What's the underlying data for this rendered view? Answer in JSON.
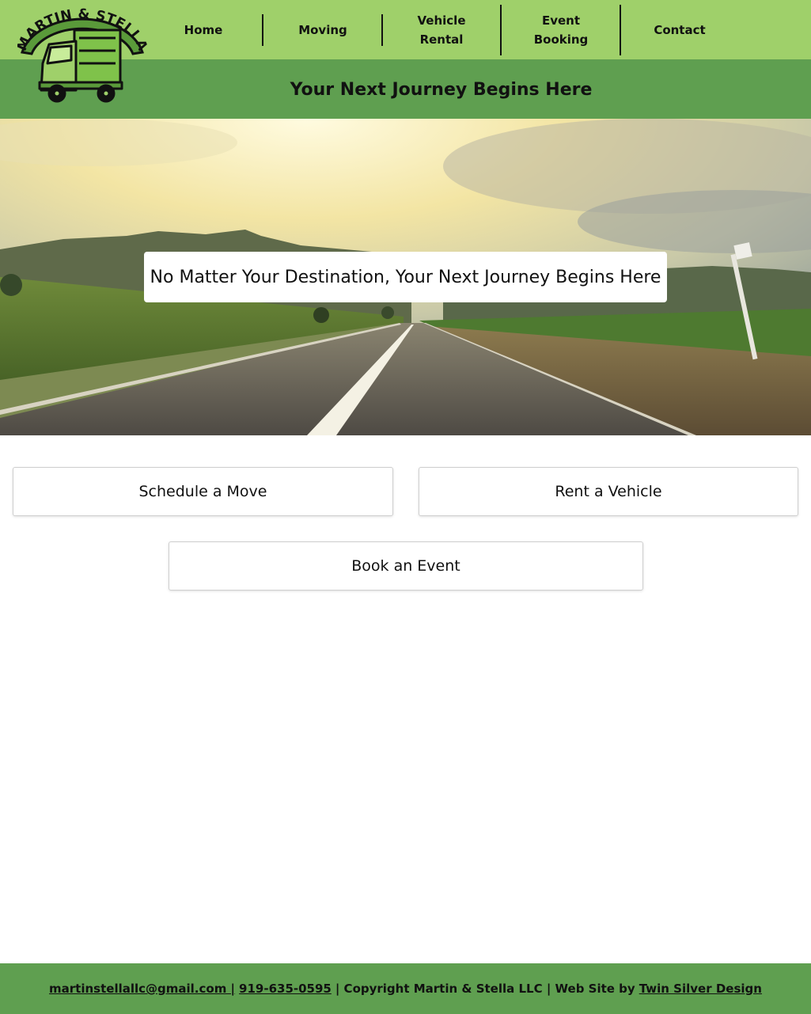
{
  "brand": {
    "logo_text": "MARTIN & STELLA"
  },
  "nav": {
    "items": [
      {
        "label": "Home"
      },
      {
        "label": "Moving"
      },
      {
        "label": "Vehicle\nRental"
      },
      {
        "label": "Event\nBooking"
      },
      {
        "label": "Contact"
      }
    ]
  },
  "subheader": {
    "title": "Your Next Journey Begins Here"
  },
  "hero": {
    "banner_text": "No Matter Your Destination, Your Next Journey Begins Here"
  },
  "actions": {
    "schedule_move": "Schedule a Move",
    "rent_vehicle": "Rent a Vehicle",
    "book_event": "Book an Event"
  },
  "footer": {
    "email": "martinstellallc@gmail.com |",
    "phone": "919-635-0595",
    "copyright": "| Copyright Martin & Stella LLC | Web Site by",
    "designer": "Twin Silver Design"
  },
  "colors": {
    "nav_bg": "#9fd06a",
    "band_bg": "#5f9f50",
    "accent": "#7fc24a"
  },
  "icons": {
    "logo": "truck-icon"
  }
}
